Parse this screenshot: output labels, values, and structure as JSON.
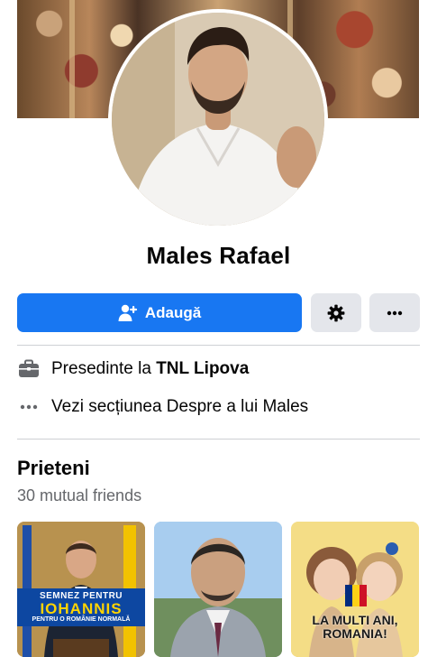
{
  "profile": {
    "name": "Males Rafael"
  },
  "actions": {
    "add_label": "Adaugă",
    "add_icon": "add-friend-icon",
    "settings_icon": "gear-icon",
    "more_icon": "more-dots-icon"
  },
  "about": {
    "work_prefix": "Presedinte la ",
    "work_place": "TNL Lipova",
    "work_icon": "briefcase-icon",
    "see_about": "Vezi secțiunea Despre a lui Males",
    "see_about_icon": "more-dots-icon"
  },
  "friends": {
    "title": "Prieteni",
    "mutual": "30 mutual friends",
    "cards": [
      {
        "banner_line1": "SEMNEZ PENTRU",
        "banner_line2": "IOHANNIS",
        "banner_line3": "PENTRU O ROMÂNIE NORMALĂ"
      },
      {},
      {
        "banner_line1": "LA MULTI ANI,",
        "banner_line2": "ROMANIA!"
      }
    ]
  },
  "colors": {
    "primary": "#1877f2",
    "secondary_button": "#e4e6eb",
    "divider": "#ced0d4",
    "muted_text": "#65676b"
  }
}
